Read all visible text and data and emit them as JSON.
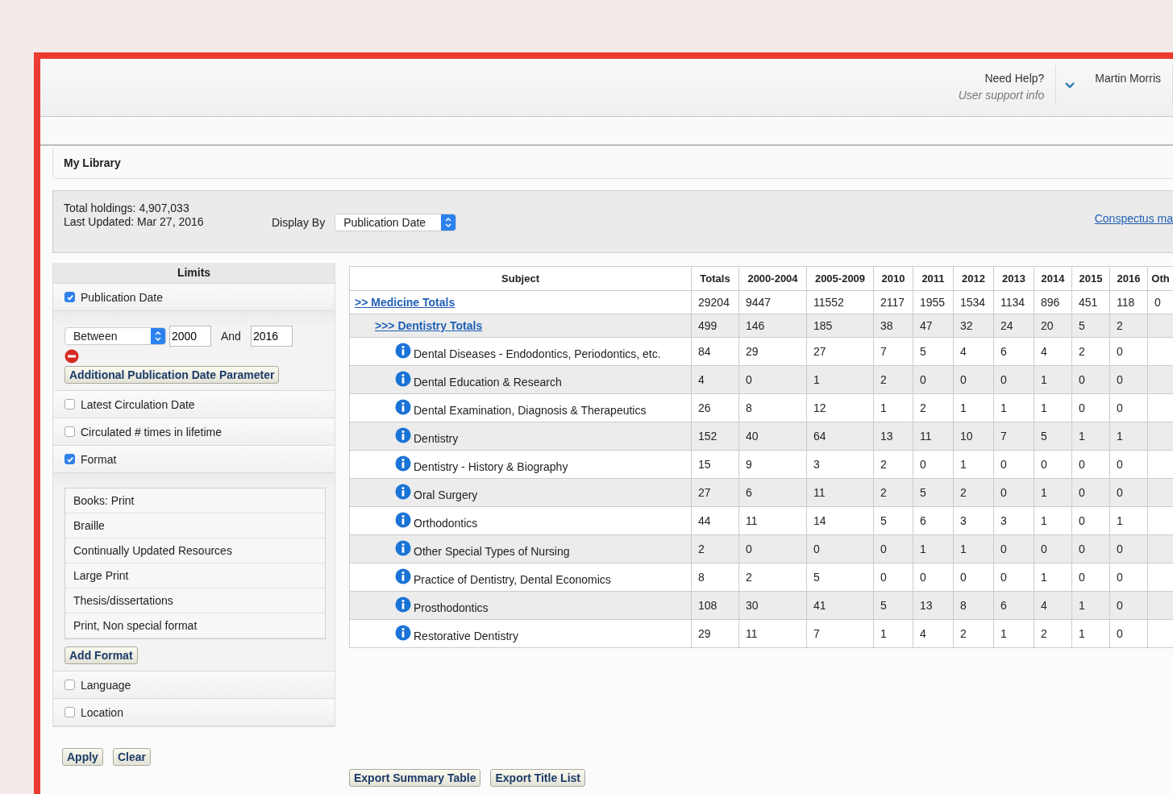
{
  "header": {
    "help_title": "Need Help?",
    "help_subtitle": "User support info",
    "user_name": "Martin Morris"
  },
  "breadcrumb": "My Library",
  "summary": {
    "total_holdings": "Total holdings: 4,907,033",
    "last_updated": "Last Updated: Mar 27, 2016",
    "display_by_label": "Display By",
    "display_by_value": "Publication Date",
    "link": "Conspectus ma"
  },
  "limits": {
    "title": "Limits",
    "sections": [
      {
        "kind": "date",
        "label": "Publication Date",
        "checked": true,
        "operator": "Between",
        "from": "2000",
        "and_label": "And",
        "to": "2016",
        "button": "Additional Publication Date Parameter"
      },
      {
        "kind": "plain",
        "label": "Latest Circulation Date",
        "checked": false
      },
      {
        "kind": "plain",
        "label": "Circulated # times in lifetime",
        "checked": false
      },
      {
        "kind": "list",
        "label": "Format",
        "checked": true,
        "items": [
          "Books: Print",
          "Braille",
          "Continually Updated Resources",
          "Large Print",
          "Thesis/dissertations",
          "Print, Non special format"
        ],
        "button": "Add Format"
      },
      {
        "kind": "plain",
        "label": "Language",
        "checked": false
      },
      {
        "kind": "plain",
        "label": "Location",
        "checked": false
      }
    ],
    "buttons": [
      "Apply",
      "Clear"
    ]
  },
  "table": {
    "columns": [
      "Subject",
      "Totals",
      "2000-2004",
      "2005-2009",
      "2010",
      "2011",
      "2012",
      "2013",
      "2014",
      "2015",
      "2016",
      "Oth"
    ],
    "rows": [
      {
        "kind": "total",
        "subject": ">> Medicine Totals",
        "values": [
          "29204",
          "9447",
          "11552",
          "2117",
          "1955",
          "1534",
          "1134",
          "896",
          "451",
          "118",
          "0"
        ],
        "children": [
          {
            "kind": "total",
            "subject": ">>> Dentistry Totals",
            "values": [
              "499",
              "146",
              "185",
              "38",
              "47",
              "32",
              "24",
              "20",
              "5",
              "2"
            ],
            "children": [
              {
                "kind": "subject",
                "subject": "Dental Diseases - Endodontics, Periodontics, etc.",
                "values": [
                  "84",
                  "29",
                  "27",
                  "7",
                  "5",
                  "4",
                  "6",
                  "4",
                  "2",
                  "0"
                ]
              },
              {
                "kind": "subject",
                "subject": "Dental Education & Research",
                "values": [
                  "4",
                  "0",
                  "1",
                  "2",
                  "0",
                  "0",
                  "0",
                  "1",
                  "0",
                  "0"
                ]
              },
              {
                "kind": "subject",
                "subject": "Dental Examination, Diagnosis & Therapeutics",
                "values": [
                  "26",
                  "8",
                  "12",
                  "1",
                  "2",
                  "1",
                  "1",
                  "1",
                  "0",
                  "0"
                ]
              },
              {
                "kind": "subject",
                "subject": "Dentistry",
                "values": [
                  "152",
                  "40",
                  "64",
                  "13",
                  "11",
                  "10",
                  "7",
                  "5",
                  "1",
                  "1"
                ]
              },
              {
                "kind": "subject",
                "subject": "Dentistry - History & Biography",
                "values": [
                  "15",
                  "9",
                  "3",
                  "2",
                  "0",
                  "1",
                  "0",
                  "0",
                  "0",
                  "0"
                ]
              },
              {
                "kind": "subject",
                "subject": "Oral Surgery",
                "values": [
                  "27",
                  "6",
                  "11",
                  "2",
                  "5",
                  "2",
                  "0",
                  "1",
                  "0",
                  "0"
                ]
              },
              {
                "kind": "subject",
                "subject": "Orthodontics",
                "values": [
                  "44",
                  "11",
                  "14",
                  "5",
                  "6",
                  "3",
                  "3",
                  "1",
                  "0",
                  "1"
                ]
              },
              {
                "kind": "subject",
                "subject": "Other Special Types of Nursing",
                "values": [
                  "2",
                  "0",
                  "0",
                  "0",
                  "1",
                  "1",
                  "0",
                  "0",
                  "0",
                  "0"
                ]
              },
              {
                "kind": "subject",
                "subject": "Practice of Dentistry, Dental Economics",
                "values": [
                  "8",
                  "2",
                  "5",
                  "0",
                  "0",
                  "0",
                  "0",
                  "1",
                  "0",
                  "0"
                ]
              },
              {
                "kind": "subject",
                "subject": "Prosthodontics",
                "values": [
                  "108",
                  "30",
                  "41",
                  "5",
                  "13",
                  "8",
                  "6",
                  "4",
                  "1",
                  "0"
                ]
              },
              {
                "kind": "subject",
                "subject": "Restorative Dentistry",
                "values": [
                  "29",
                  "11",
                  "7",
                  "1",
                  "4",
                  "2",
                  "1",
                  "2",
                  "1",
                  "0"
                ]
              }
            ]
          }
        ]
      }
    ]
  },
  "export_buttons": [
    "Export Summary Table",
    "Export Title List"
  ]
}
